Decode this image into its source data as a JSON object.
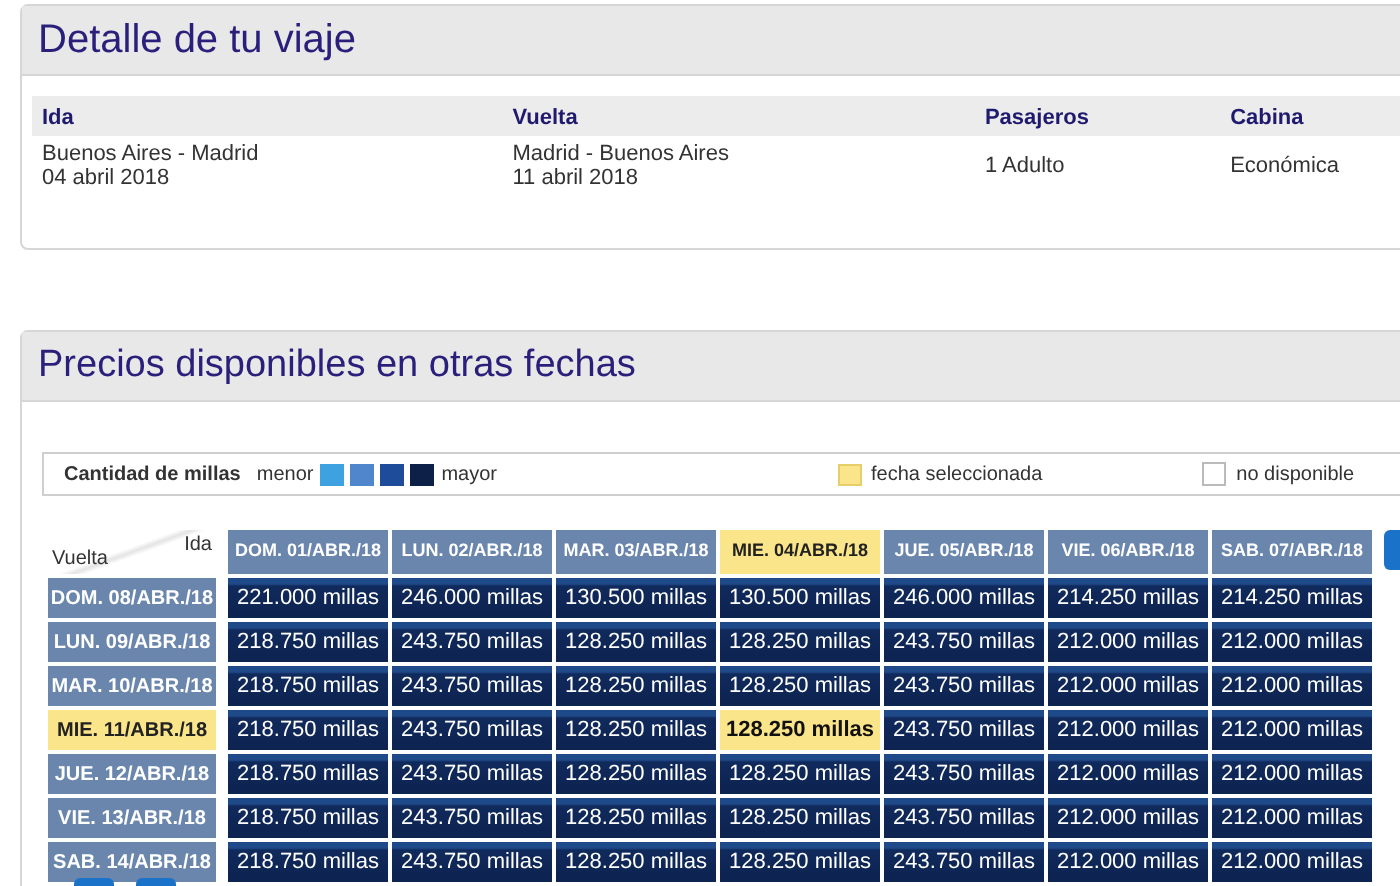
{
  "trip_panel": {
    "title": "Detalle de tu viaje",
    "columns": [
      "Ida",
      "Vuelta",
      "Pasajeros",
      "Cabina"
    ],
    "row": [
      [
        "Buenos Aires - Madrid",
        "04 abril 2018"
      ],
      [
        "Madrid - Buenos Aires",
        "11 abril 2018"
      ],
      [
        "1 Adulto"
      ],
      [
        "Económica"
      ]
    ]
  },
  "prices_panel": {
    "title": "Precios disponibles en otras fechas",
    "legend": {
      "label": "Cantidad de millas",
      "low": "menor",
      "high": "mayor",
      "swatches": [
        {
          "color": "#3fa2e0"
        },
        {
          "color": "#4f86cc"
        },
        {
          "color": "#1f4c9a"
        },
        {
          "color": "#0d2148"
        }
      ],
      "selected_label": "fecha seleccionada",
      "unavailable_label": "no disponible"
    },
    "corner": {
      "top": "Ida",
      "bottom": "Vuelta"
    },
    "columns": [
      {
        "label": "DOM. 01/ABR./18",
        "selected": false
      },
      {
        "label": "LUN. 02/ABR./18",
        "selected": false
      },
      {
        "label": "MAR. 03/ABR./18",
        "selected": false
      },
      {
        "label": "MIE. 04/ABR./18",
        "selected": true
      },
      {
        "label": "JUE. 05/ABR./18",
        "selected": false
      },
      {
        "label": "VIE. 06/ABR./18",
        "selected": false
      },
      {
        "label": "SAB. 07/ABR./18",
        "selected": false
      }
    ],
    "rows": [
      {
        "label": "DOM. 08/ABR./18",
        "selected": false,
        "cells": [
          "221.000 millas",
          "246.000 millas",
          "130.500 millas",
          "130.500 millas",
          "246.000 millas",
          "214.250 millas",
          "214.250 millas"
        ]
      },
      {
        "label": "LUN. 09/ABR./18",
        "selected": false,
        "cells": [
          "218.750 millas",
          "243.750 millas",
          "128.250 millas",
          "128.250 millas",
          "243.750 millas",
          "212.000 millas",
          "212.000 millas"
        ]
      },
      {
        "label": "MAR. 10/ABR./18",
        "selected": false,
        "cells": [
          "218.750 millas",
          "243.750 millas",
          "128.250 millas",
          "128.250 millas",
          "243.750 millas",
          "212.000 millas",
          "212.000 millas"
        ]
      },
      {
        "label": "MIE. 11/ABR./18",
        "selected": true,
        "cells": [
          "218.750 millas",
          "243.750 millas",
          "128.250 millas",
          "128.250 millas",
          "243.750 millas",
          "212.000 millas",
          "212.000 millas"
        ]
      },
      {
        "label": "JUE. 12/ABR./18",
        "selected": false,
        "cells": [
          "218.750 millas",
          "243.750 millas",
          "128.250 millas",
          "128.250 millas",
          "243.750 millas",
          "212.000 millas",
          "212.000 millas"
        ]
      },
      {
        "label": "VIE. 13/ABR./18",
        "selected": false,
        "cells": [
          "218.750 millas",
          "243.750 millas",
          "128.250 millas",
          "128.250 millas",
          "243.750 millas",
          "212.000 millas",
          "212.000 millas"
        ]
      },
      {
        "label": "SAB. 14/ABR./18",
        "selected": false,
        "cells": [
          "218.750 millas",
          "243.750 millas",
          "128.250 millas",
          "128.250 millas",
          "243.750 millas",
          "212.000 millas",
          "212.000 millas"
        ]
      }
    ]
  }
}
